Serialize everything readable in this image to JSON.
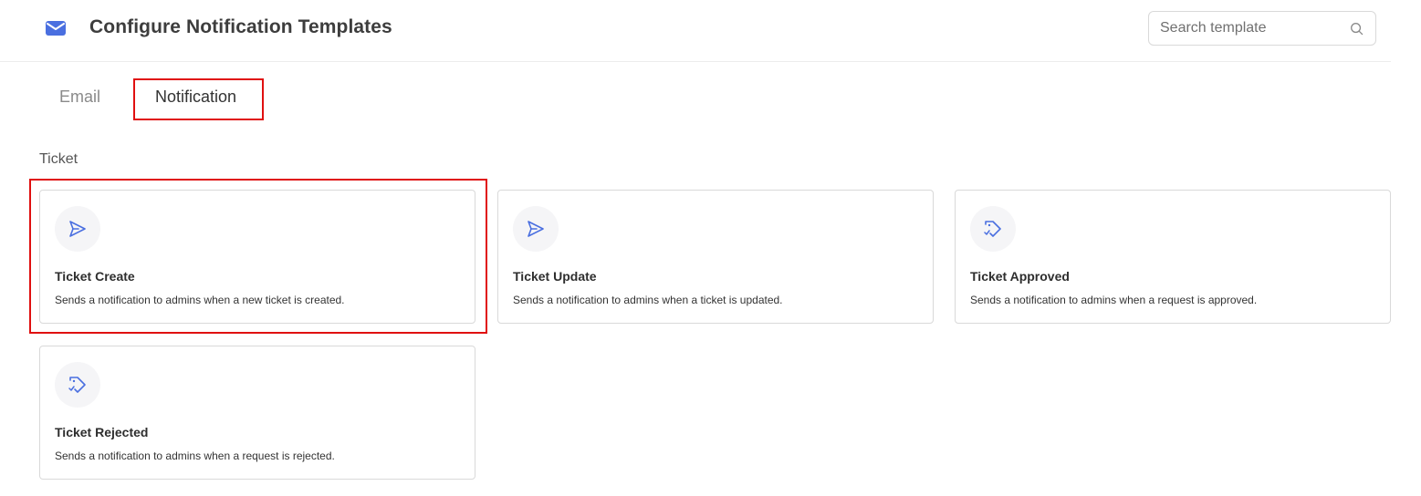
{
  "header": {
    "title": "Configure Notification Templates",
    "icon": "envelope-icon",
    "search": {
      "placeholder": "Search template",
      "value": "",
      "icon": "search-icon"
    }
  },
  "tabs": [
    {
      "label": "Email",
      "selected": false
    },
    {
      "label": "Notification",
      "selected": true
    }
  ],
  "section": {
    "title": "Ticket"
  },
  "cards": [
    {
      "title": "Ticket Create",
      "description": "Sends a notification to admins when a new ticket is created.",
      "icon": "send-icon"
    },
    {
      "title": "Ticket Update",
      "description": "Sends a notification to admins when a ticket is updated.",
      "icon": "send-icon"
    },
    {
      "title": "Ticket Approved",
      "description": "Sends a notification to admins when a request is approved.",
      "icon": "tag-check-icon"
    },
    {
      "title": "Ticket Rejected",
      "description": "Sends a notification to admins when a request is rejected.",
      "icon": "tag-check-icon"
    }
  ],
  "colors": {
    "accent": "#4a6fe0",
    "highlight": "#e01010",
    "border": "#d9d9d9"
  }
}
